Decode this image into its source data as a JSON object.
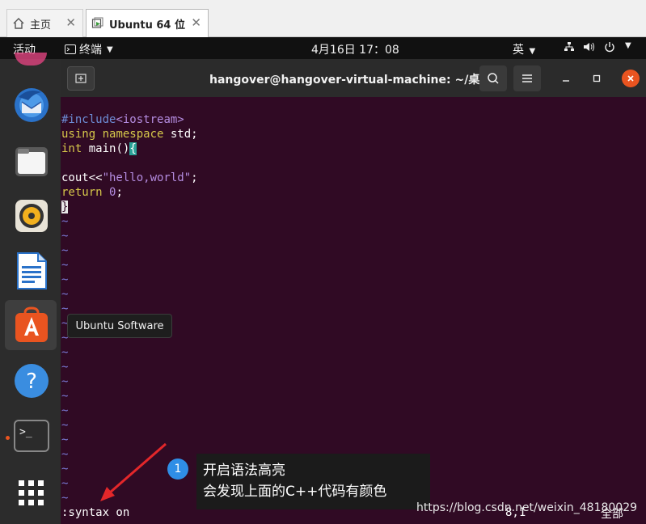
{
  "host_tabs": [
    {
      "label": "主页",
      "icon": "home-icon"
    },
    {
      "label": "Ubuntu 64 位",
      "icon": "vm-icon"
    }
  ],
  "topbar": {
    "activities": "活动",
    "app_menu": "终端",
    "clock": "4月16日  17：08",
    "ime": "英"
  },
  "dock": {
    "items": [
      "thunderbird-icon",
      "files-icon",
      "rhythmbox-icon",
      "writer-icon",
      "ubuntu-software-icon",
      "help-icon",
      "terminal-icon",
      "show-apps-icon"
    ],
    "tooltip": "Ubuntu Software"
  },
  "terminal": {
    "title": "hangover@hangover-virtual-machine: ~/桌面",
    "code": {
      "include_kw": "#include",
      "include_hdr": "<iostream>",
      "using_kw": "using",
      "namespace_kw": "namespace",
      "std_rest": " std;",
      "int_kw": "int",
      "main_rest": " main()",
      "open_brace": "{",
      "cout_text": "cout<<",
      "string_literal": "\"hello,world\"",
      "semicolon": ";",
      "return_kw": "return",
      "zero": "0",
      "close_brace": "}"
    },
    "tilde": "~",
    "command": ":syntax on",
    "ruler": "8,1",
    "ruler_all": "全部"
  },
  "annotation": {
    "number": "1",
    "line1": "开启语法高亮",
    "line2": "会发现上面的C++代码有颜色"
  },
  "watermark": "https://blog.csdn.net/weixin_48180029",
  "colors": {
    "terminal_bg": "#300a24",
    "ubuntu_orange": "#e95420",
    "keyword": "#d6c84a",
    "preproc": "#6d8dd6",
    "string": "#b48ce0"
  }
}
